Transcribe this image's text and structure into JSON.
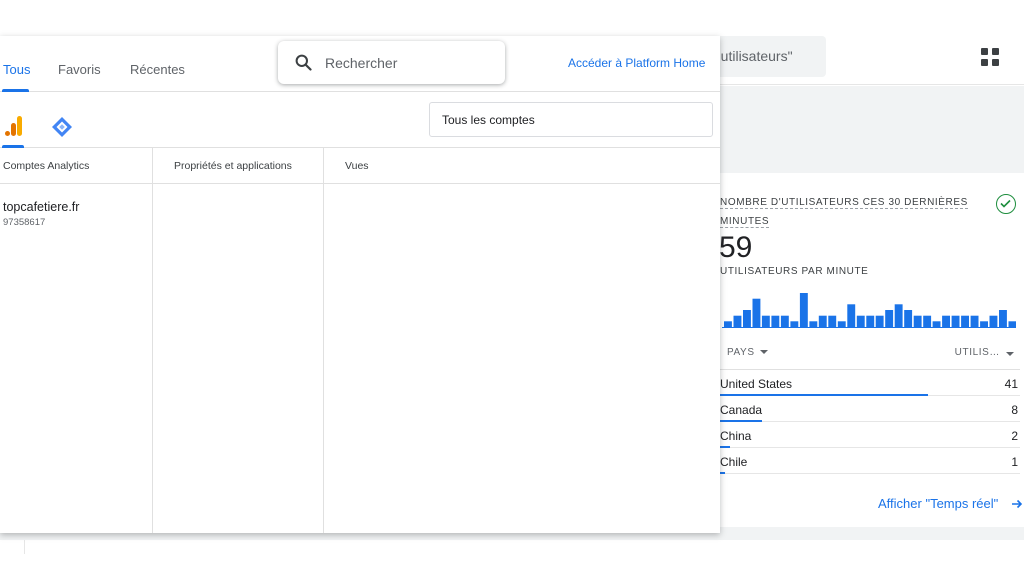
{
  "background": {
    "search_text": "'utilisateurs\""
  },
  "realtime": {
    "title": "NOMBRE D'UTILISATEURS CES 30 DERNIÈRES MINUTES",
    "count": "59",
    "per_minute_label": "UTILISATEURS PAR MINUTE",
    "per_minute_bars": [
      1,
      2,
      3,
      5,
      2,
      2,
      2,
      1,
      6,
      1,
      2,
      2,
      1,
      4,
      2,
      2,
      2,
      3,
      4,
      3,
      2,
      2,
      1,
      2,
      2,
      2,
      2,
      1,
      2,
      3,
      1
    ],
    "bar_color": "#1a73e8",
    "table": {
      "col_country": "PAYS",
      "col_users": "UTILIS…",
      "rows": [
        {
          "country": "United States",
          "users": "41",
          "share": 1.0
        },
        {
          "country": "Canada",
          "users": "8",
          "share": 0.2
        },
        {
          "country": "China",
          "users": "2",
          "share": 0.05
        },
        {
          "country": "Chile",
          "users": "1",
          "share": 0.025
        }
      ]
    },
    "link": "Afficher \"Temps réel\""
  },
  "picker": {
    "tabs": [
      {
        "label": "Tous",
        "active": true
      },
      {
        "label": "Favoris",
        "active": false
      },
      {
        "label": "Récentes",
        "active": false
      }
    ],
    "search_placeholder": "Rechercher",
    "platform_link": "Accéder à Platform Home",
    "account_filter": "Tous les comptes",
    "columns": {
      "accounts": "Comptes Analytics",
      "properties": "Propriétés et applications",
      "views": "Vues"
    },
    "accounts": [
      {
        "name": "topcafetiere.fr",
        "id": "97358617"
      }
    ]
  },
  "colors": {
    "accent": "#1a73e8",
    "analytics_orange": "#f9ab00",
    "analytics_dark": "#e37400",
    "gtm_blue": "#4285f4",
    "check_green": "#1e8e3e"
  }
}
